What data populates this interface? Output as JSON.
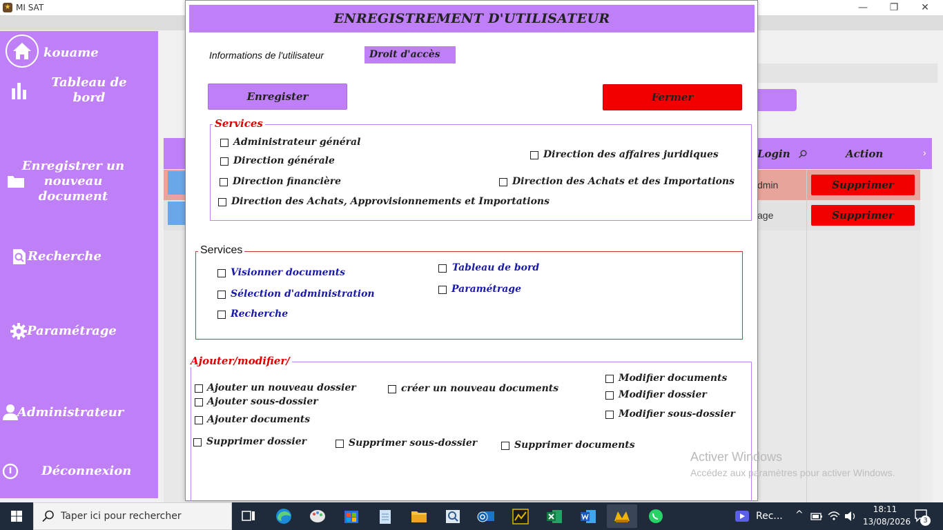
{
  "window": {
    "title": "MI SAT",
    "controls": {
      "minimize": "—",
      "restore": "❐",
      "close": "✕"
    }
  },
  "sidebar": {
    "user": "kouame",
    "items": [
      {
        "label_line1": "Tableau de",
        "label_line2": "bord",
        "icon": "bar-chart-icon"
      },
      {
        "label_line1": "Enregistrer un",
        "label_line2": "nouveau",
        "label_line3": "document",
        "icon": "folder-icon"
      },
      {
        "label": "Recherche",
        "icon": "search-doc-icon"
      },
      {
        "label": "Paramétrage",
        "icon": "gear-icon"
      },
      {
        "label": "Administrateur",
        "icon": "user-icon"
      },
      {
        "label": "Déconnexion",
        "icon": "power-icon"
      }
    ]
  },
  "background_table": {
    "headers": {
      "login": "Login",
      "action": "Action"
    },
    "rows": [
      {
        "login": "dmin",
        "action": "Supprimer"
      },
      {
        "login": "age",
        "action": "Supprimer"
      }
    ]
  },
  "dialog": {
    "title": "ENREGISTREMENT D'UTILISATEUR",
    "tabs": {
      "info": "Informations de l'utilisateur",
      "droit": "Droit d'accès"
    },
    "buttons": {
      "save": "Enregister",
      "close": "Fermer"
    },
    "group1": {
      "legend": "Services",
      "items": [
        "Administrateur général",
        "Direction générale",
        "Direction financière",
        "Direction des Achats, Approvisionnements et Importations",
        "Direction des affaires juridiques",
        "Direction des Achats et des Importations"
      ]
    },
    "group2": {
      "legend": "Services",
      "items": [
        "Visionner documents",
        "Sélection d'administration",
        "Recherche",
        "Tableau de bord",
        "Paramétrage"
      ]
    },
    "group3": {
      "legend": "Ajouter/modifier/",
      "items": [
        "Ajouter un nouveau dossier",
        "Ajouter sous-dossier",
        "Ajouter documents",
        "Supprimer dossier",
        "créer un nouveau documents",
        "Supprimer sous-dossier",
        "Supprimer documents",
        "Modifier documents",
        "Modifier dossier",
        "Modifier sous-dossier"
      ]
    }
  },
  "watermark": {
    "line1": "Activer Windows",
    "line2": "Accédez aux paramètres pour activer Windows."
  },
  "taskbar": {
    "search_placeholder": "Taper ici pour rechercher",
    "rec_label": "Rec...",
    "time": "18:11",
    "date": "13/08/2026",
    "notifications": "3"
  },
  "colors": {
    "accent": "#bf80f7",
    "danger": "#f20000",
    "blue_label": "#1a1aa8",
    "legend_red": "#e00000"
  }
}
